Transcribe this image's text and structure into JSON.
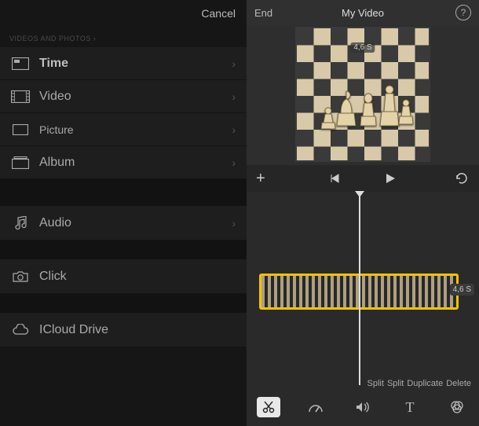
{
  "left": {
    "cancel": "Cancel",
    "section_header": "VIDEOS AND PHOTOS ›",
    "items": [
      {
        "label": "Time",
        "icon": "moments-icon",
        "bold": true
      },
      {
        "label": "Video",
        "icon": "video-icon",
        "bold": false
      },
      {
        "label": "Picture",
        "icon": "photo-icon",
        "bold": false
      },
      {
        "label": "Album",
        "icon": "album-icon",
        "bold": false
      }
    ],
    "audio": {
      "label": "Audio"
    },
    "click": {
      "label": "Click"
    },
    "icloud": {
      "label": "ICloud Drive"
    }
  },
  "editor": {
    "end_label": "End",
    "title": "My Video",
    "preview_duration": "4,6 S",
    "clip_duration": "4,6 S",
    "actions": [
      "Split",
      "Split",
      "Duplicate",
      "Delete"
    ],
    "tools": [
      "scissors",
      "speed",
      "volume",
      "text",
      "filter"
    ]
  }
}
